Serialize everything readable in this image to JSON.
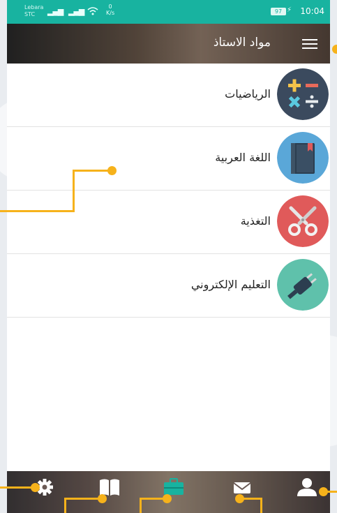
{
  "status_bar": {
    "carrier_top": "Lebara",
    "carrier_bottom": "STC",
    "network": "4G",
    "data_speed": "0",
    "data_unit": "K/s",
    "battery": "97",
    "time": "10:04"
  },
  "header": {
    "title": "مواد الاستاذ",
    "menu_icon": "hamburger-menu-icon"
  },
  "subjects": [
    {
      "label": "الرياضيات",
      "icon": "math-operators-icon",
      "color": "#3b4a5e"
    },
    {
      "label": "اللغة العربية",
      "icon": "book-icon",
      "color": "#5aa7d8"
    },
    {
      "label": "التغذية",
      "icon": "scissors-icon",
      "color": "#e05a5a"
    },
    {
      "label": "التعليم الإلكتروني",
      "icon": "plug-icon",
      "color": "#5fc1ab"
    }
  ],
  "bottom_nav": [
    {
      "name": "settings",
      "icon": "gear-icon",
      "active": false
    },
    {
      "name": "library",
      "icon": "book-open-icon",
      "active": false
    },
    {
      "name": "materials",
      "icon": "briefcase-icon",
      "active": true
    },
    {
      "name": "messages",
      "icon": "envelope-icon",
      "active": false
    },
    {
      "name": "profile",
      "icon": "user-icon",
      "active": false
    }
  ],
  "colors": {
    "accent": "#18b3a0",
    "annotation": "#f6b21b"
  }
}
